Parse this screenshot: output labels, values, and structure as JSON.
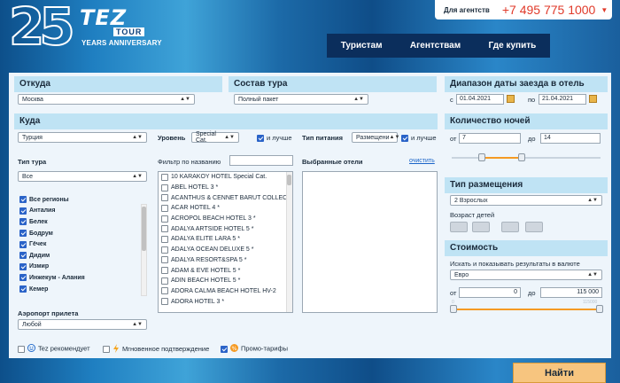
{
  "header": {
    "logo_num": "25",
    "logo_tez": "TEZ",
    "logo_tour": "TOUR",
    "logo_anniv": "YEARS ANNIVERSARY",
    "agent_label": "Для агентств",
    "phone": "+7 495 775 1000",
    "nav": [
      "Туристам",
      "Агентствам",
      "Где купить"
    ]
  },
  "from": {
    "title": "Откуда",
    "value": "Москва"
  },
  "composition": {
    "title": "Состав тура",
    "value": "Полный пакет"
  },
  "dates": {
    "title": "Диапазон даты заезда в отель",
    "from_label": "с",
    "from_value": "01.04.2021",
    "to_label": "по",
    "to_value": "21.04.2021"
  },
  "where": {
    "title": "Куда",
    "country": "Турция",
    "level_label": "Уровень",
    "level_value": "Special Cat.",
    "better_label": "и лучше",
    "meal_label": "Тип питания",
    "meal_value": "Размещени",
    "meal_better": "и лучше",
    "tour_type_label": "Тип тура",
    "tour_type_value": "Все",
    "filter_label": "Фильтр по названию",
    "selected_label": "Выбранные отели",
    "clear_label": "очистить",
    "regions": [
      {
        "label": "Все регионы",
        "checked": true,
        "bold": true
      },
      {
        "label": "Анталия",
        "checked": true,
        "bold": true
      },
      {
        "label": "Белек",
        "checked": true,
        "bold": true
      },
      {
        "label": "Бодрум",
        "checked": true,
        "bold": true
      },
      {
        "label": "Гёчек",
        "checked": true,
        "bold": true
      },
      {
        "label": "Дидим",
        "checked": true,
        "bold": true
      },
      {
        "label": "Измир",
        "checked": true,
        "bold": true
      },
      {
        "label": "Инжекум - Алания",
        "checked": true,
        "bold": true
      },
      {
        "label": "Кемер",
        "checked": true,
        "bold": true
      }
    ],
    "hotels": [
      "10 KARAKOY HOTEL Special Cat.",
      "ABEL HOTEL 3 *",
      "ACANTHUS & CENNET BARUT COLLEC",
      "ACAR HOTEL 4 *",
      "ACROPOL BEACH HOTEL 3 *",
      "ADALYA ARTSIDE HOTEL 5 *",
      "ADALYA ELITE LARA 5 *",
      "ADALYA OCEAN DELUXE 5 *",
      "ADALYA RESORT&SPA 5 *",
      "ADAM & EVE HOTEL 5 *",
      "ADIN BEACH HOTEL 5 *",
      "ADORA CALMA BEACH HOTEL HV-2",
      "ADORA HOTEL 3 *"
    ],
    "airport_label": "Аэропорт прилета",
    "airport_value": "Любой"
  },
  "nights": {
    "title": "Количество ночей",
    "from_label": "от",
    "from_value": "7",
    "to_label": "до",
    "to_value": "14"
  },
  "accommodation": {
    "title": "Тип размещения",
    "value": "2 Взрослых",
    "children_label": "Возраст детей"
  },
  "cost": {
    "title": "Стоимость",
    "currency_label": "Искать и показывать результаты в валюте",
    "currency": "Евро",
    "from_label": "от",
    "from_value": "0",
    "to_label": "до",
    "to_value": "115 000",
    "scale_min": "0",
    "scale_max": "115000"
  },
  "options": {
    "recommend": "Tez рекомендует",
    "instant": "Мгновенное подтверждение",
    "promo": "Промо-тарифы"
  },
  "find_button": "Найти",
  "colors": {
    "accent": "#f59a23",
    "header_panel": "#bfe3f4",
    "nav": "#0b2e5c",
    "phone": "#e03a2a"
  }
}
